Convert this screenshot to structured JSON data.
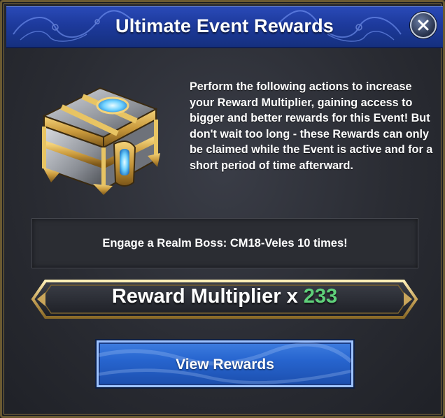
{
  "dialog": {
    "title": "Ultimate Event Rewards",
    "description": "Perform the following actions to increase your Reward Multiplier, gaining access to bigger and better rewards for this Event! But don't wait too long - these Rewards can only be claimed while the Event is active and for a short period of time afterward.",
    "task": "Engage a Realm Boss: CM18-Veles 10 times!",
    "multiplier_label": "Reward Multiplier x",
    "multiplier_value": "233",
    "view_rewards_label": "View Rewards"
  },
  "icons": {
    "close": "close-icon",
    "chest": "treasure-chest-icon"
  },
  "colors": {
    "header_blue": "#1d3a9c",
    "multiplier_green": "#5fd07a",
    "button_blue": "#2765cf",
    "gold_trim": "#c9a55a"
  }
}
